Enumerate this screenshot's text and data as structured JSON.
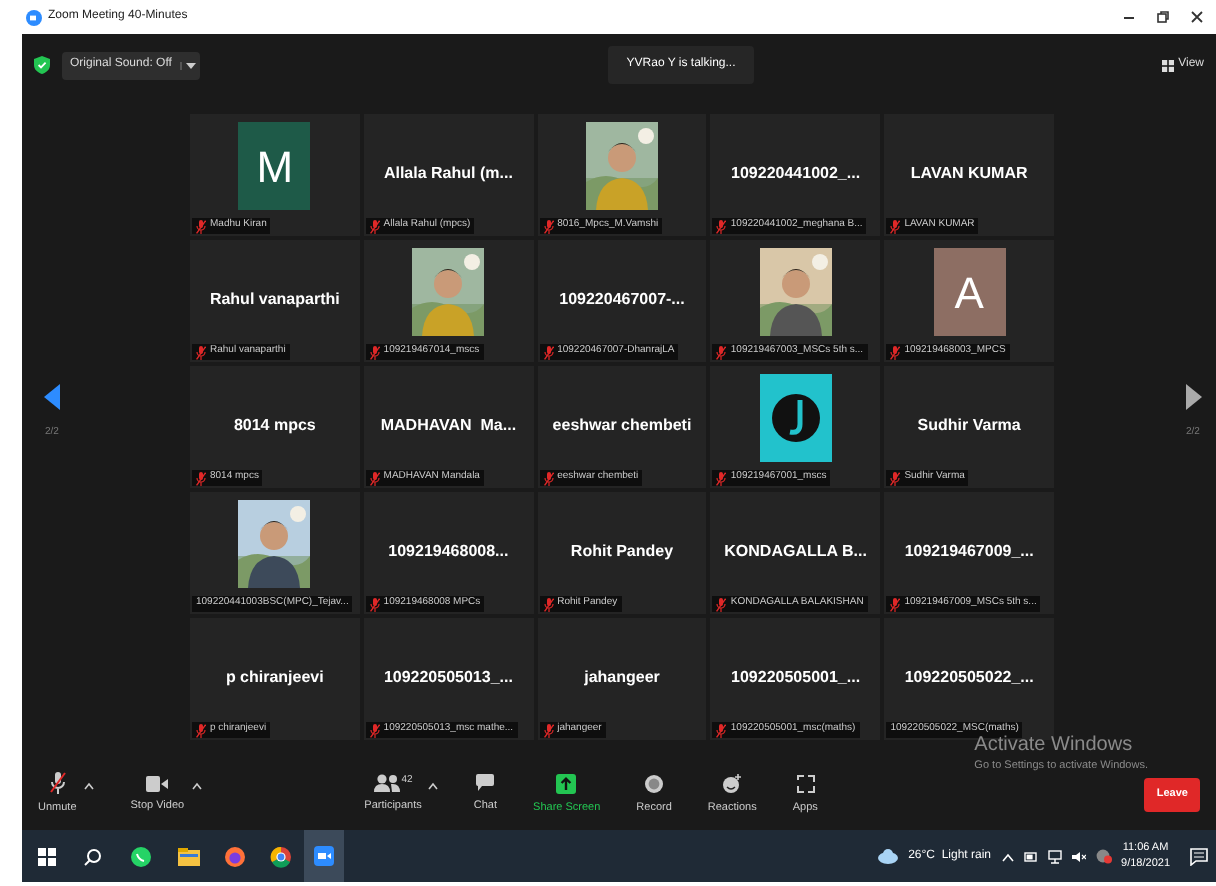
{
  "window": {
    "title": "Zoom Meeting 40-Minutes"
  },
  "top_bar": {
    "audio": "Original Sound: Off",
    "talking": "YVRao Y is talking...",
    "view": "View"
  },
  "pager": {
    "left": "2/2",
    "right": "2/2"
  },
  "tiles": [
    {
      "kind": "avatar",
      "letter": "M",
      "color": "#1e5a48",
      "label": "Madhu Kiran",
      "muted": true
    },
    {
      "kind": "name",
      "name": "Allala Rahul (m...",
      "label": "Allala Rahul (mpcs)",
      "muted": true
    },
    {
      "label": "8016_Mpcs_M.Vamshi",
      "muted": true
    },
    {
      "kind": "name",
      "name": "109220441002_...",
      "label": "109220441002_meghana B...",
      "muted": true
    },
    {
      "kind": "name",
      "name": "LAVAN KUMAR",
      "label": "LAVAN KUMAR",
      "muted": true
    },
    {
      "kind": "name",
      "name": "Rahul vanaparthi",
      "label": "Rahul vanaparthi",
      "muted": true
    },
    {
      "label": "109219467014_mscs",
      "muted": true
    },
    {
      "kind": "name",
      "name": "109220467007-...",
      "label": "109220467007-DhanrajLA",
      "muted": true
    },
    {
      "label": "109219467003_MSCs 5th s...",
      "muted": true
    },
    {
      "kind": "avatar",
      "letter": "A",
      "color": "#8d6e63",
      "label": "109219468003_MPCS",
      "muted": true
    },
    {
      "kind": "name",
      "name": "8014 mpcs",
      "label": "8014 mpcs",
      "muted": true
    },
    {
      "kind": "name",
      "name": "MADHAVAN  Ma...",
      "label": "MADHAVAN Mandala",
      "muted": true
    },
    {
      "kind": "name",
      "name": "eeshwar chembeti",
      "label": "eeshwar chembeti",
      "muted": true
    },
    {
      "kind": "logo",
      "label": "109219467001_mscs",
      "muted": true
    },
    {
      "kind": "name",
      "name": "Sudhir Varma",
      "label": "Sudhir Varma",
      "muted": true
    },
    {
      "label": "109220441003BSC(MPC)_Tejav...",
      "muted": false
    },
    {
      "kind": "name",
      "name": "109219468008...",
      "label": "109219468008 MPCs",
      "muted": true
    },
    {
      "kind": "name",
      "name": "Rohit Pandey",
      "label": "Rohit Pandey",
      "muted": true
    },
    {
      "kind": "name",
      "name": "KONDAGALLA B...",
      "label": "KONDAGALLA BALAKISHAN",
      "muted": true
    },
    {
      "kind": "name",
      "name": "109219467009_...",
      "label": "109219467009_MSCs 5th s...",
      "muted": true
    },
    {
      "kind": "name",
      "name": "p chiranjeevi",
      "label": "p chiranjeevi",
      "muted": true
    },
    {
      "kind": "name",
      "name": "109220505013_...",
      "label": "109220505013_msc mathe...",
      "muted": true
    },
    {
      "kind": "name",
      "name": "jahangeer",
      "label": "jahangeer",
      "muted": true
    },
    {
      "kind": "name",
      "name": "109220505001_...",
      "label": "109220505001_msc(maths)",
      "muted": true
    },
    {
      "kind": "name",
      "name": "109220505022_...",
      "label": "109220505022_MSC(maths)",
      "muted": false
    }
  ],
  "toolbar": {
    "unmute": "Unmute",
    "stop_video": "Stop Video",
    "participants": "Participants",
    "participant_count": "42",
    "chat": "Chat",
    "share_screen": "Share Screen",
    "record": "Record",
    "reactions": "Reactions",
    "apps": "Apps",
    "leave": "Leave"
  },
  "activate_windows": {
    "title": "Activate Windows",
    "text": "Go to Settings to activate Windows."
  },
  "taskbar": {
    "weather": "26°C  Light rain",
    "time": "11:06 AM",
    "date": "9/18/2021"
  }
}
